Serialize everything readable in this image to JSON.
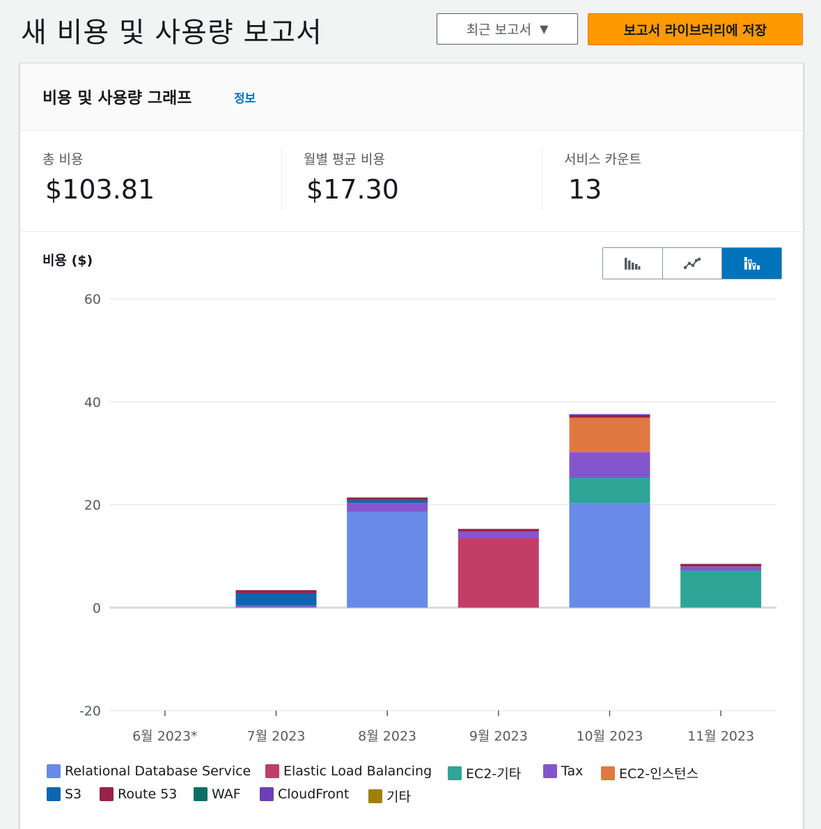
{
  "page": {
    "title": "새 비용 및 사용량 보고서",
    "recent_reports_label": "최근 보고서",
    "save_label": "보고서 라이브러리에 저장"
  },
  "panel": {
    "title": "비용 및 사용량 그래프",
    "info_link": "정보"
  },
  "stats": [
    {
      "label": "총 비용",
      "value": "$103.81"
    },
    {
      "label": "월별 평균 비용",
      "value": "$17.30"
    },
    {
      "label": "서비스 카운트",
      "value": "13"
    }
  ],
  "chart_controls": {
    "options": [
      "bar-chart-icon",
      "line-chart-icon",
      "stacked-bar-chart-icon"
    ],
    "selected": "stacked-bar-chart-icon"
  },
  "colors": {
    "accent_orange": "#ff9900",
    "link_blue": "#0073bb"
  },
  "chart_data": {
    "type": "bar",
    "stacked": true,
    "ylabel": "비용 ($)",
    "ylim": [
      -20,
      60
    ],
    "yticks": [
      -20,
      0,
      20,
      40,
      60
    ],
    "grid": true,
    "legend_position": "bottom",
    "categories": [
      "6월 2023*",
      "7월 2023",
      "8월 2023",
      "9월 2023",
      "10월 2023",
      "11월 2023"
    ],
    "series": [
      {
        "name": "Relational Database Service",
        "color": "#688ae8",
        "values": [
          0,
          0,
          18.6,
          0,
          20.3,
          0
        ]
      },
      {
        "name": "Elastic Load Balancing",
        "color": "#c33d69",
        "values": [
          0,
          0,
          0,
          13.5,
          0,
          0
        ]
      },
      {
        "name": "EC2-기타",
        "color": "#2ea597",
        "values": [
          0,
          0.1,
          0,
          0,
          4.9,
          7.2
        ]
      },
      {
        "name": "Tax",
        "color": "#8456ce",
        "values": [
          0,
          0.3,
          1.8,
          1.3,
          5.0,
          0.8
        ]
      },
      {
        "name": "EC2-인스턴스",
        "color": "#e07941",
        "values": [
          0,
          0,
          0,
          0,
          6.7,
          0
        ]
      },
      {
        "name": "S3",
        "color": "#0e65b0",
        "values": [
          0,
          2.4,
          0.5,
          0,
          0,
          0
        ]
      },
      {
        "name": "Route 53",
        "color": "#962249",
        "values": [
          0,
          0.6,
          0.5,
          0.5,
          0.5,
          0.5
        ]
      },
      {
        "name": "WAF",
        "color": "#096f64",
        "values": [
          0,
          0,
          0,
          0,
          0,
          0
        ]
      },
      {
        "name": "CloudFront",
        "color": "#6b40b2",
        "values": [
          0,
          0,
          0,
          0,
          0.2,
          0
        ]
      },
      {
        "name": "기타",
        "color": "#a0800d",
        "values": [
          0,
          0,
          0,
          0,
          0,
          0
        ]
      }
    ],
    "legend_rows": [
      [
        "Relational Database Service",
        "Elastic Load Balancing",
        "EC2-기타",
        "Tax",
        "EC2-인스턴스"
      ],
      [
        "S3",
        "Route 53",
        "WAF",
        "CloudFront",
        "기타"
      ]
    ]
  }
}
